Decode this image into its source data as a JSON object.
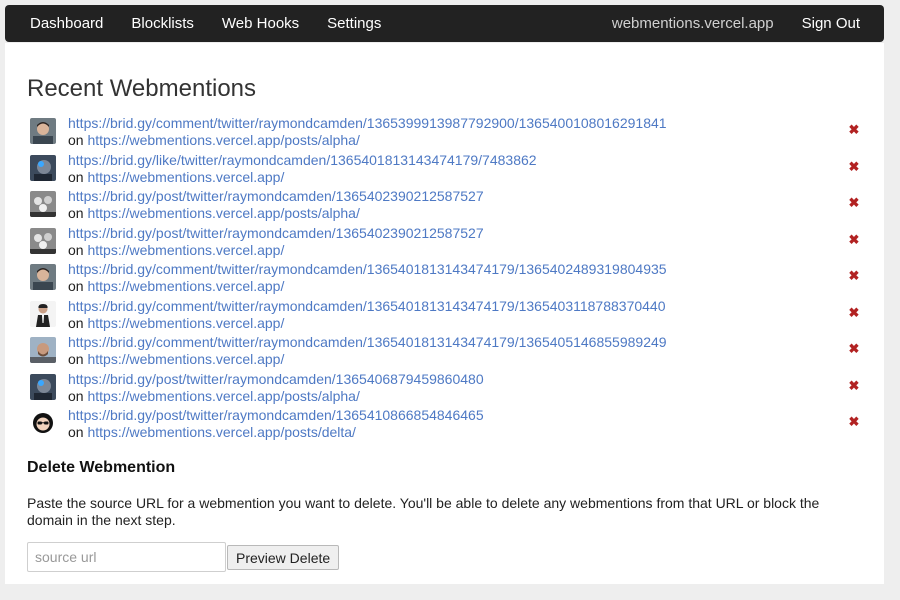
{
  "nav": {
    "left": [
      "Dashboard",
      "Blocklists",
      "Web Hooks",
      "Settings"
    ],
    "host": "webmentions.vercel.app",
    "sign_out": "Sign Out"
  },
  "title": "Recent Webmentions",
  "on_label": "on",
  "delete_glyph": "✖",
  "mentions": [
    {
      "source": "https://brid.gy/comment/twitter/raymondcamden/1365399913987792900/1365400108016291841",
      "target": "https://webmentions.vercel.app/posts/alpha/",
      "avatar": "photo-man-dark-hair"
    },
    {
      "source": "https://brid.gy/like/twitter/raymondcamden/1365401813143474179/7483862",
      "target": "https://webmentions.vercel.app/",
      "avatar": "photo-bird-avatar"
    },
    {
      "source": "https://brid.gy/post/twitter/raymondcamden/1365402390212587527",
      "target": "https://webmentions.vercel.app/posts/alpha/",
      "avatar": "photo-group-bw"
    },
    {
      "source": "https://brid.gy/post/twitter/raymondcamden/1365402390212587527",
      "target": "https://webmentions.vercel.app/",
      "avatar": "photo-group-bw"
    },
    {
      "source": "https://brid.gy/comment/twitter/raymondcamden/1365401813143474179/1365402489319804935",
      "target": "https://webmentions.vercel.app/",
      "avatar": "photo-man-dark-hair"
    },
    {
      "source": "https://brid.gy/comment/twitter/raymondcamden/1365401813143474179/1365403118788370440",
      "target": "https://webmentions.vercel.app/",
      "avatar": "photo-man-suit"
    },
    {
      "source": "https://brid.gy/comment/twitter/raymondcamden/1365401813143474179/1365405146855989249",
      "target": "https://webmentions.vercel.app/",
      "avatar": "photo-man-beard"
    },
    {
      "source": "https://brid.gy/post/twitter/raymondcamden/1365406879459860480",
      "target": "https://webmentions.vercel.app/posts/alpha/",
      "avatar": "photo-bird-avatar"
    },
    {
      "source": "https://brid.gy/post/twitter/raymondcamden/1365410866854846465",
      "target": "https://webmentions.vercel.app/posts/delta/",
      "avatar": "cartoon-avatar-sunglasses"
    }
  ],
  "delete_section": {
    "title": "Delete Webmention",
    "description": "Paste the source URL for a webmention you want to delete. You'll be able to delete any webmentions from that URL or block the domain in the next step.",
    "input_placeholder": "source url",
    "input_value": "",
    "button": "Preview Delete"
  },
  "colors": {
    "navbar": "#222222",
    "link": "#4e79c4",
    "delete": "#b22222",
    "background": "#eeeeee"
  }
}
